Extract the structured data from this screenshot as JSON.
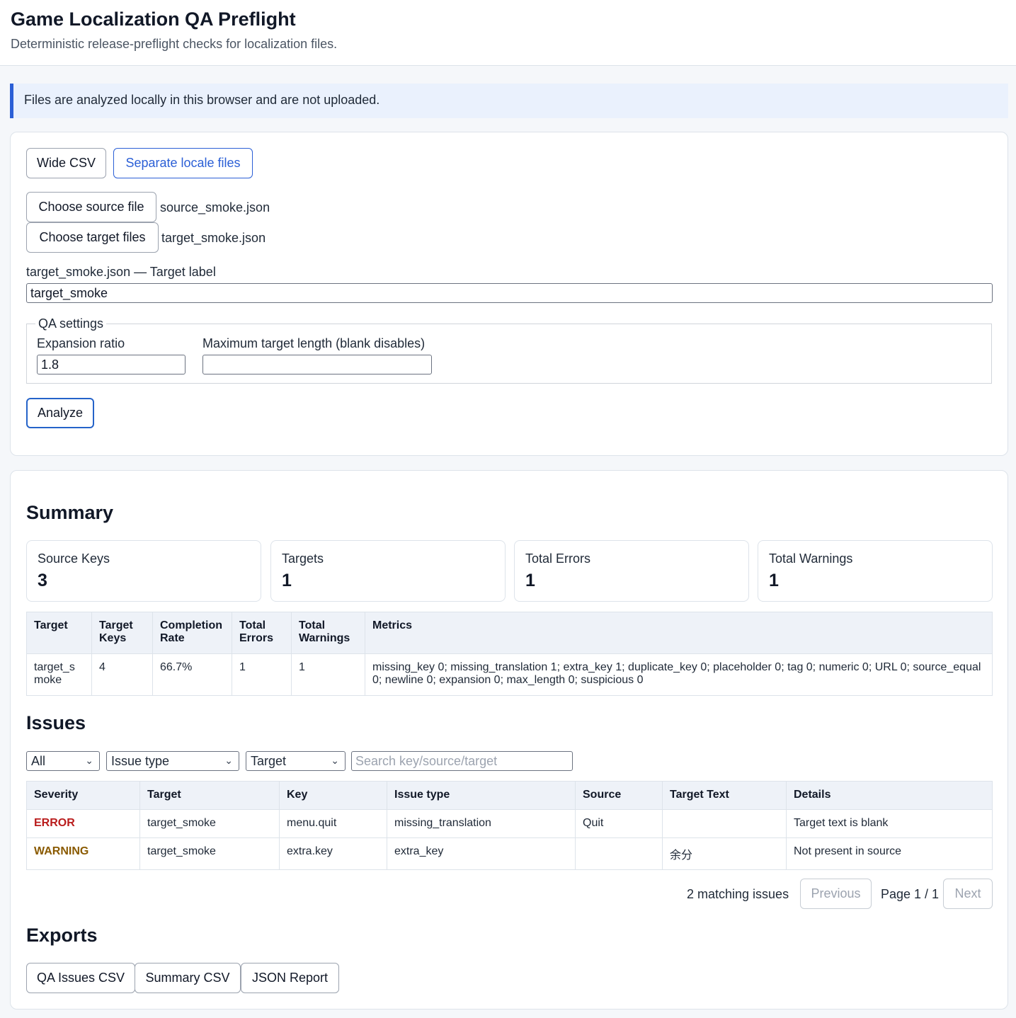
{
  "header": {
    "title": "Game Localization QA Preflight",
    "subtitle": "Deterministic release-preflight checks for localization files."
  },
  "notice": "Files are analyzed locally in this browser and are not uploaded.",
  "mode_tabs": {
    "wide_csv": "Wide CSV",
    "separate_locale": "Separate locale files"
  },
  "files": {
    "source_button": "Choose source file",
    "source_name": "source_smoke.json",
    "target_button": "Choose target files",
    "target_name": "target_smoke.json",
    "target_label_caption": "target_smoke.json — Target label",
    "target_label_value": "target_smoke"
  },
  "qa_settings": {
    "legend": "QA settings",
    "expansion_label": "Expansion ratio",
    "expansion_value": "1.8",
    "max_length_label": "Maximum target length (blank disables)",
    "max_length_value": ""
  },
  "analyze_label": "Analyze",
  "summary": {
    "heading": "Summary",
    "cards": [
      {
        "label": "Source Keys",
        "value": "3"
      },
      {
        "label": "Targets",
        "value": "1"
      },
      {
        "label": "Total Errors",
        "value": "1"
      },
      {
        "label": "Total Warnings",
        "value": "1"
      }
    ],
    "table_headers": [
      "Target",
      "Target Keys",
      "Completion Rate",
      "Total Errors",
      "Total Warnings",
      "Metrics"
    ],
    "rows": [
      {
        "target": "target_smoke",
        "target_keys": "4",
        "completion_rate": "66.7%",
        "total_errors": "1",
        "total_warnings": "1",
        "metrics": "missing_key 0; missing_translation 1; extra_key 1; duplicate_key 0; placeholder 0; tag 0; numeric 0; URL 0; source_equal 0; newline 0; expansion 0; max_length 0; suspicious 0"
      }
    ]
  },
  "issues": {
    "heading": "Issues",
    "filters": {
      "severity": "All",
      "issue_type": "Issue type",
      "target": "Target",
      "search_placeholder": "Search key/source/target"
    },
    "table_headers": [
      "Severity",
      "Target",
      "Key",
      "Issue type",
      "Source",
      "Target Text",
      "Details"
    ],
    "rows": [
      {
        "severity": "ERROR",
        "target": "target_smoke",
        "key": "menu.quit",
        "issue_type": "missing_translation",
        "source": "Quit",
        "target_text": "",
        "details": "Target text is blank"
      },
      {
        "severity": "WARNING",
        "target": "target_smoke",
        "key": "extra.key",
        "issue_type": "extra_key",
        "source": "",
        "target_text": "余分",
        "details": "Not present in source"
      }
    ],
    "matching": "2 matching issues",
    "previous": "Previous",
    "page": "Page 1 / 1",
    "next": "Next"
  },
  "exports": {
    "heading": "Exports",
    "qa_issues_csv": "QA Issues CSV",
    "summary_csv": "Summary CSV",
    "json_report": "JSON Report"
  }
}
